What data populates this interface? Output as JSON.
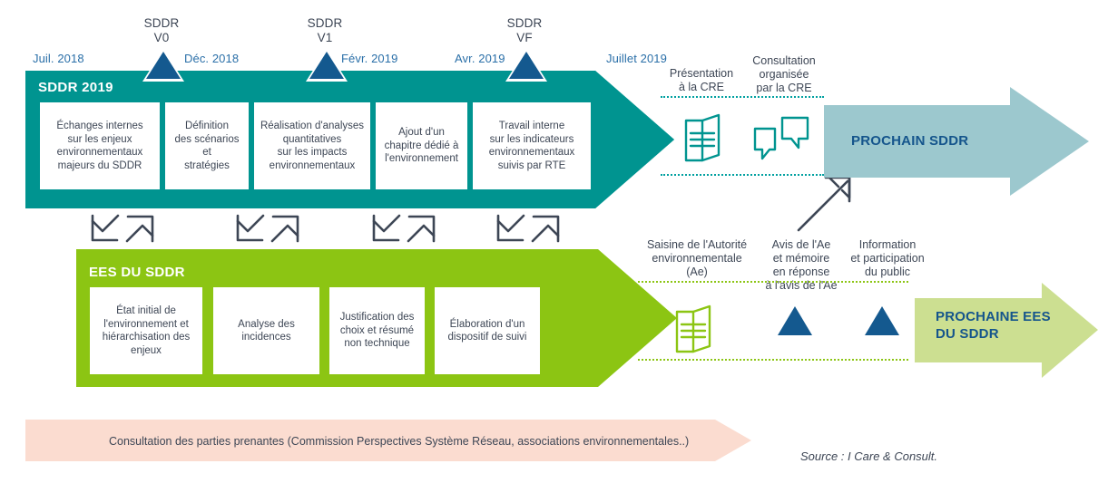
{
  "colors": {
    "teal": "#009490",
    "teal_light": "#9cc8ce",
    "green": "#8cc513",
    "green_light": "#ccdf91",
    "blue_dark": "#14598f",
    "blue_text": "#15558c",
    "date_blue": "#2a6fa8",
    "pink": "#fbdcd0",
    "slate": "#3d4655",
    "white": "#ffffff"
  },
  "timeline": {
    "milestones": [
      {
        "name": "SDDR\nV0",
        "date_after": "Déc. 2018"
      },
      {
        "name": "SDDR\nV1",
        "date_after": "Févr. 2019"
      },
      {
        "name": "SDDR\nVF",
        "date_after": ""
      }
    ],
    "dates": [
      "Juil. 2018",
      "Déc. 2018",
      "Févr. 2019",
      "Avr. 2019",
      "Juillet 2019"
    ]
  },
  "sddr_band": {
    "title": "SDDR 2019",
    "steps": [
      "Échanges internes\nsur les enjeux\nenvironnementaux\nmajeurs du SDDR",
      "Définition\ndes scénarios et\nstratégies",
      "Réalisation d'analyses\nquantitatives\nsur les impacts\nenvironnementaux",
      "Ajout d'un\nchapitre dédié à\nl'environnement",
      "Travail interne\nsur les indicateurs\nenvironnementaux\nsuivis par RTE"
    ]
  },
  "ees_band": {
    "title": "EES DU SDDR",
    "steps": [
      "État initial de\nl'environnement et\nhiérarchisation des\nenjeux",
      "Analyse des\nincidences",
      "Justification des\nchoix et résumé\nnon technique",
      "Élaboration d'un\ndispositif de suivi"
    ]
  },
  "cre_phase": {
    "labels": [
      "Présentation\nà la CRE",
      "Consultation\norganisée\npar la CRE"
    ],
    "icons": [
      "document-icon",
      "speech-bubbles-icon"
    ]
  },
  "ae_phase": {
    "labels": [
      "Saisine de l'Autorité\nenvironnementale\n(Ae)",
      "Avis de l'Ae\net mémoire\nen réponse\nà l'avis de l'Ae",
      "Information\net participation\ndu public"
    ],
    "icons": [
      "document-icon",
      "triangle-marker",
      "triangle-marker"
    ]
  },
  "next_sddr": {
    "label": "PROCHAIN SDDR"
  },
  "next_ees": {
    "label": "PROCHAINE EES\nDU SDDR"
  },
  "consultation": {
    "label": "Consultation des parties prenantes (Commission Perspectives Système Réseau, associations environnementales..)"
  },
  "source": {
    "label": "Source : I Care & Consult."
  }
}
